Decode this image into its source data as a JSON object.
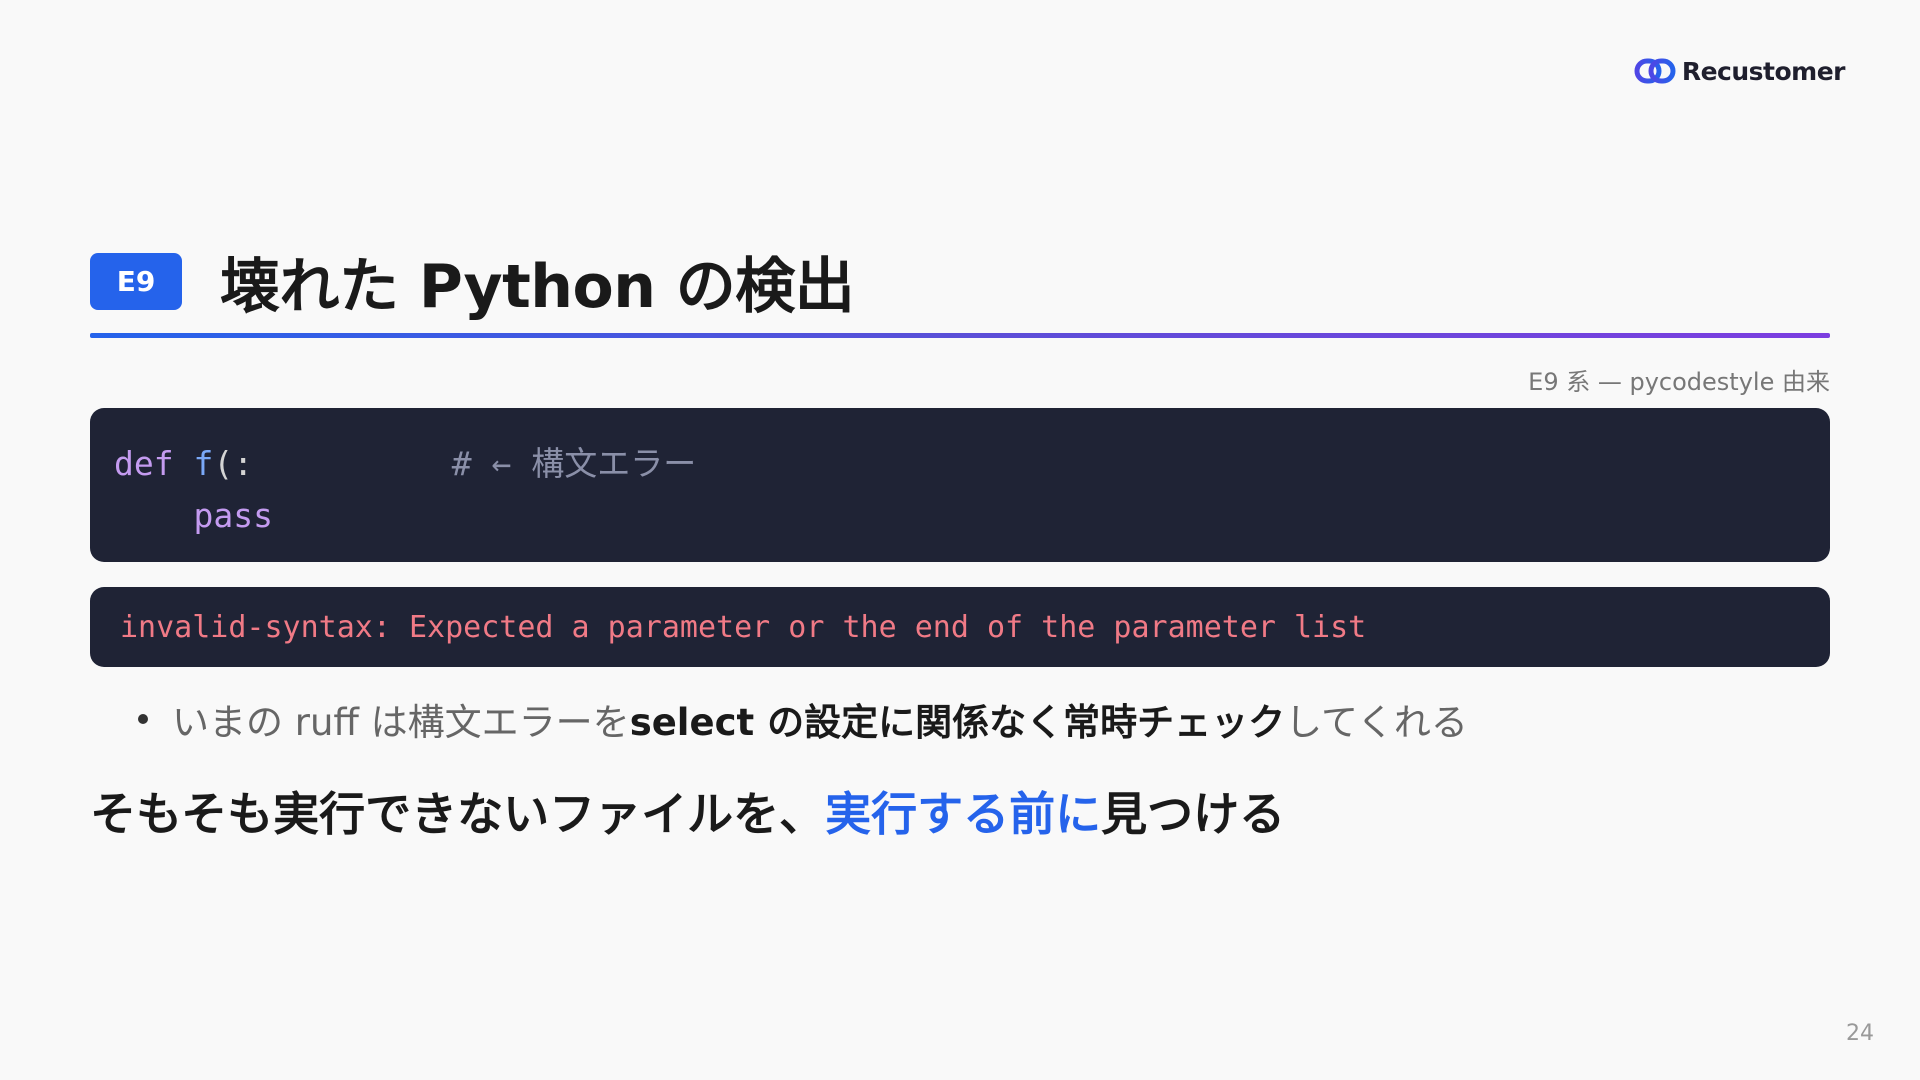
{
  "logo": {
    "text": "Recustomer",
    "icon": "chain-link-logo-icon",
    "colors": [
      "#4f46e5",
      "#2563eb"
    ]
  },
  "header": {
    "badge": "E9",
    "title": "壊れた Python の検出"
  },
  "source_note": "E9 系 — pycodestyle 由来",
  "code": {
    "line1": {
      "keyword": "def",
      "function": "f",
      "punct": "(:",
      "comment": "# ← 構文エラー"
    },
    "line2": {
      "indent": "    ",
      "keyword": "pass"
    }
  },
  "error_message": "invalid-syntax: Expected a parameter or the end of the parameter list",
  "bullet": {
    "before": "いまの ruff は構文エラーを ",
    "highlight": "select の設定に関係なく常時チェック",
    "after": "してくれる"
  },
  "tagline": {
    "before": "そもそも実行できないファイルを、",
    "accent": "実行する前に",
    "after": "見つける"
  },
  "page_number": "24",
  "colors": {
    "accent": "#2563eb",
    "code_bg": "#1f2335",
    "error_text": "#f07a86",
    "keyword": "#c49bf0",
    "function": "#7aa8f7"
  }
}
